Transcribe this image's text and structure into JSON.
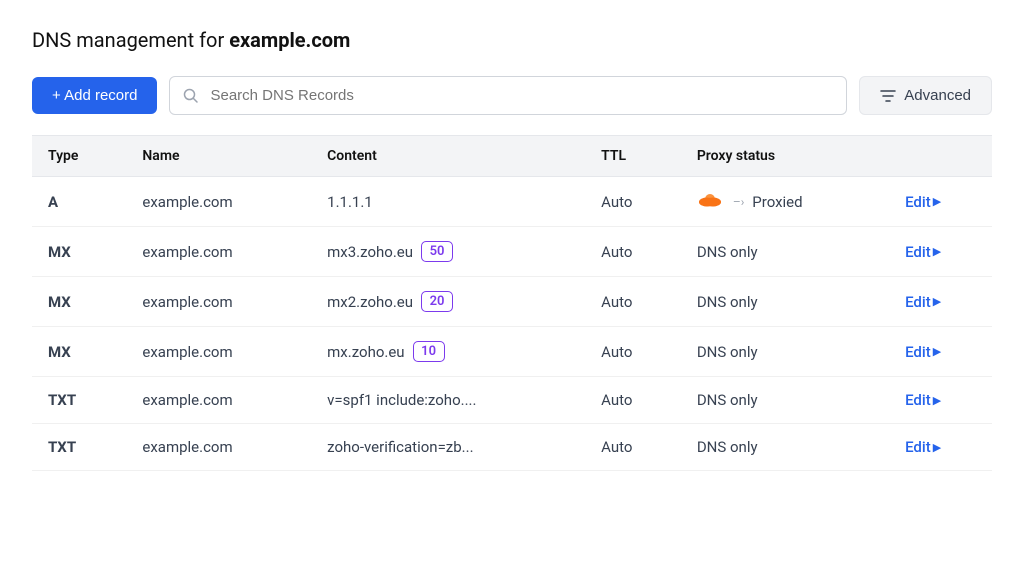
{
  "page": {
    "title_prefix": "DNS management for ",
    "title_domain": "example.com"
  },
  "toolbar": {
    "add_record_label": "+ Add record",
    "search_placeholder": "Search DNS Records",
    "advanced_label": "Advanced"
  },
  "table": {
    "columns": [
      "Type",
      "Name",
      "Content",
      "TTL",
      "Proxy status"
    ],
    "rows": [
      {
        "type": "A",
        "name": "example.com",
        "content": "1.1.1.1",
        "priority": null,
        "ttl": "Auto",
        "proxy_status": "Proxied",
        "proxy_icon": "🟠",
        "edit_label": "Edit"
      },
      {
        "type": "MX",
        "name": "example.com",
        "content": "mx3.zoho.eu",
        "priority": "50",
        "ttl": "Auto",
        "proxy_status": "DNS only",
        "proxy_icon": null,
        "edit_label": "Edit"
      },
      {
        "type": "MX",
        "name": "example.com",
        "content": "mx2.zoho.eu",
        "priority": "20",
        "ttl": "Auto",
        "proxy_status": "DNS only",
        "proxy_icon": null,
        "edit_label": "Edit"
      },
      {
        "type": "MX",
        "name": "example.com",
        "content": "mx.zoho.eu",
        "priority": "10",
        "ttl": "Auto",
        "proxy_status": "DNS only",
        "proxy_icon": null,
        "edit_label": "Edit"
      },
      {
        "type": "TXT",
        "name": "example.com",
        "content": "v=spf1 include:zoho....",
        "priority": null,
        "ttl": "Auto",
        "proxy_status": "DNS only",
        "proxy_icon": null,
        "edit_label": "Edit"
      },
      {
        "type": "TXT",
        "name": "example.com",
        "content": "zoho-verification=zb...",
        "priority": null,
        "ttl": "Auto",
        "proxy_status": "DNS only",
        "proxy_icon": null,
        "edit_label": "Edit"
      }
    ]
  }
}
